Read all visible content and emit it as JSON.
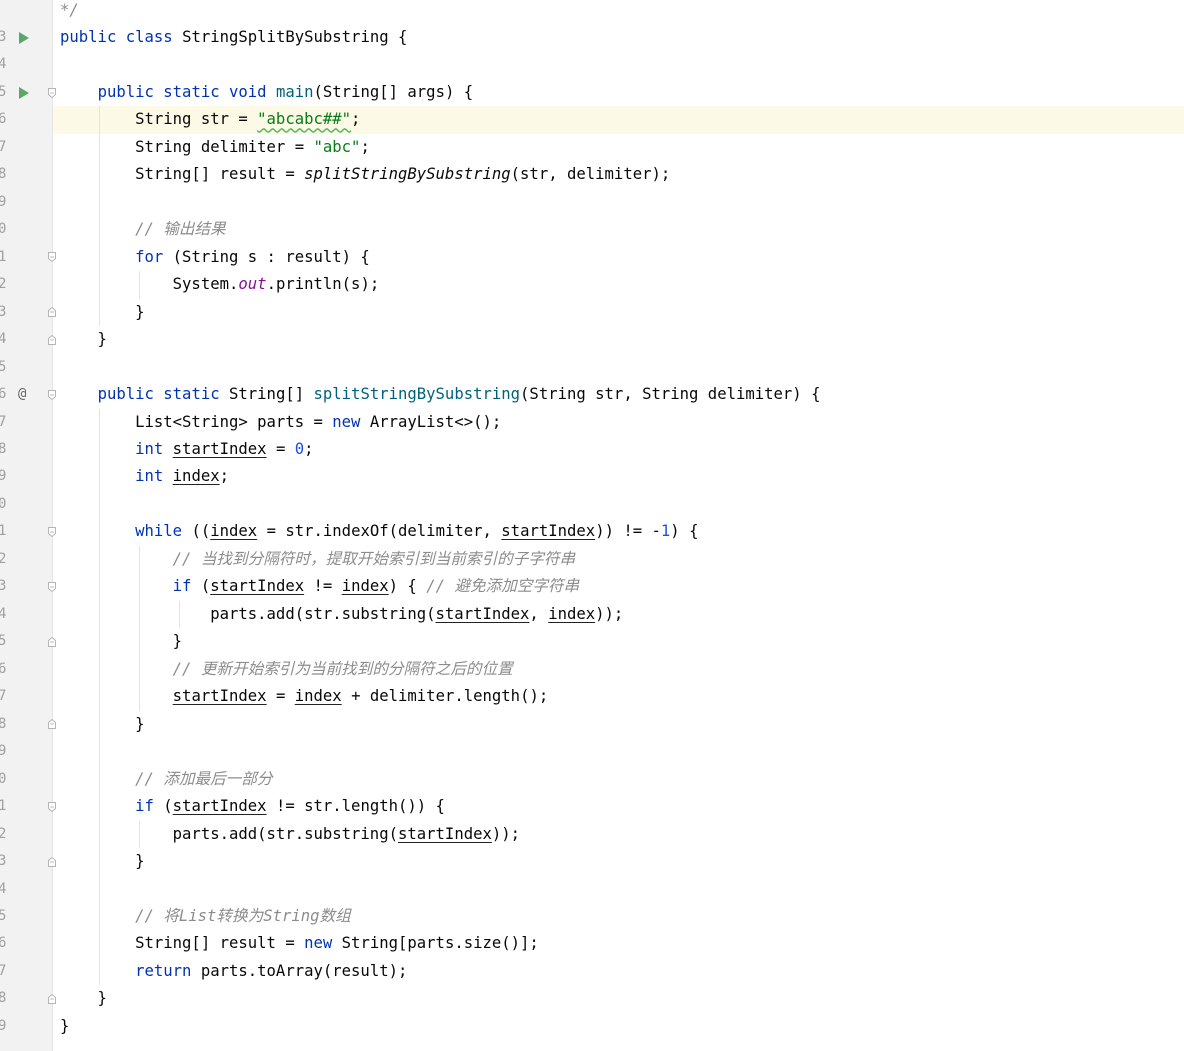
{
  "editor": {
    "line_numbers": [
      "",
      "3",
      "4",
      "5",
      "6",
      "7",
      "8",
      "9",
      "0",
      "1",
      "2",
      "3",
      "4",
      "5",
      "6",
      "7",
      "8",
      "9",
      "0",
      "1",
      "2",
      "3",
      "4",
      "5",
      "6",
      "7",
      "8",
      "9",
      "0",
      "1",
      "2",
      "3",
      "4",
      "5",
      "6",
      "7",
      "8",
      "9"
    ],
    "lines": [
      [
        {
          "t": "*/",
          "c": "cmt"
        }
      ],
      [
        {
          "t": "public class ",
          "c": "kw"
        },
        {
          "t": "StringSplitBySubstring {"
        }
      ],
      [],
      [
        {
          "t": "    "
        },
        {
          "t": "public static void ",
          "c": "kw"
        },
        {
          "t": "main",
          "c": "fn"
        },
        {
          "t": "(String[] args) {"
        }
      ],
      [
        {
          "t": "        String str = "
        },
        {
          "t": "\"abcabc##\"",
          "c": "str"
        },
        {
          "t": ";"
        }
      ],
      [
        {
          "t": "        String delimiter = "
        },
        {
          "t": "\"abc\"",
          "c": "str"
        },
        {
          "t": ";"
        }
      ],
      [
        {
          "t": "        String[] result = "
        },
        {
          "t": "splitStringBySubstring",
          "c": "static"
        },
        {
          "t": "(str, delimiter);"
        }
      ],
      [],
      [
        {
          "t": "        "
        },
        {
          "t": "// 输出结果",
          "c": "cmt"
        }
      ],
      [
        {
          "t": "        "
        },
        {
          "t": "for ",
          "c": "kw"
        },
        {
          "t": "(String s : result) {"
        }
      ],
      [
        {
          "t": "            System."
        },
        {
          "t": "out",
          "c": "field"
        },
        {
          "t": ".println(s);"
        }
      ],
      [
        {
          "t": "        }"
        }
      ],
      [
        {
          "t": "    }"
        }
      ],
      [],
      [
        {
          "t": "    "
        },
        {
          "t": "public static ",
          "c": "kw"
        },
        {
          "t": "String[] "
        },
        {
          "t": "splitStringBySubstring",
          "c": "fn"
        },
        {
          "t": "(String str, String delimiter) {"
        }
      ],
      [
        {
          "t": "        List<String> parts = "
        },
        {
          "t": "new ",
          "c": "kw"
        },
        {
          "t": "ArrayList<>();"
        }
      ],
      [
        {
          "t": "        "
        },
        {
          "t": "int ",
          "c": "kw"
        },
        {
          "t": "startIndex",
          "c": "ul"
        },
        {
          "t": " = "
        },
        {
          "t": "0",
          "c": "num"
        },
        {
          "t": ";"
        }
      ],
      [
        {
          "t": "        "
        },
        {
          "t": "int ",
          "c": "kw"
        },
        {
          "t": "index",
          "c": "ul"
        },
        {
          "t": ";"
        }
      ],
      [],
      [
        {
          "t": "        "
        },
        {
          "t": "while ",
          "c": "kw"
        },
        {
          "t": "(("
        },
        {
          "t": "index",
          "c": "ul"
        },
        {
          "t": " = str.indexOf(delimiter, "
        },
        {
          "t": "startIndex",
          "c": "ul"
        },
        {
          "t": ")) != -"
        },
        {
          "t": "1",
          "c": "num"
        },
        {
          "t": ") {"
        }
      ],
      [
        {
          "t": "            "
        },
        {
          "t": "// 当找到分隔符时，提取开始索引到当前索引的子字符串",
          "c": "cmt"
        }
      ],
      [
        {
          "t": "            "
        },
        {
          "t": "if ",
          "c": "kw"
        },
        {
          "t": "("
        },
        {
          "t": "startIndex",
          "c": "ul"
        },
        {
          "t": " != "
        },
        {
          "t": "index",
          "c": "ul"
        },
        {
          "t": ") { "
        },
        {
          "t": "// 避免添加空字符串",
          "c": "cmt"
        }
      ],
      [
        {
          "t": "                parts.add(str.substring("
        },
        {
          "t": "startIndex",
          "c": "ul"
        },
        {
          "t": ", "
        },
        {
          "t": "index",
          "c": "ul"
        },
        {
          "t": "));"
        }
      ],
      [
        {
          "t": "            }"
        }
      ],
      [
        {
          "t": "            "
        },
        {
          "t": "// 更新开始索引为当前找到的分隔符之后的位置",
          "c": "cmt"
        }
      ],
      [
        {
          "t": "            "
        },
        {
          "t": "startIndex",
          "c": "ul"
        },
        {
          "t": " = "
        },
        {
          "t": "index",
          "c": "ul"
        },
        {
          "t": " + delimiter.length();"
        }
      ],
      [
        {
          "t": "        }"
        }
      ],
      [],
      [
        {
          "t": "        "
        },
        {
          "t": "// 添加最后一部分",
          "c": "cmt"
        }
      ],
      [
        {
          "t": "        "
        },
        {
          "t": "if ",
          "c": "kw"
        },
        {
          "t": "("
        },
        {
          "t": "startIndex",
          "c": "ul"
        },
        {
          "t": " != str.length()) {"
        }
      ],
      [
        {
          "t": "            parts.add(str.substring("
        },
        {
          "t": "startIndex",
          "c": "ul"
        },
        {
          "t": "));"
        }
      ],
      [
        {
          "t": "        }"
        }
      ],
      [],
      [
        {
          "t": "        "
        },
        {
          "t": "// 将List转换为String数组",
          "c": "cmt"
        }
      ],
      [
        {
          "t": "        String[] result = "
        },
        {
          "t": "new ",
          "c": "kw"
        },
        {
          "t": "String[parts.size()];"
        }
      ],
      [
        {
          "t": "        "
        },
        {
          "t": "return ",
          "c": "kw"
        },
        {
          "t": "parts.toArray(result);"
        }
      ],
      [
        {
          "t": "    }"
        }
      ],
      [
        {
          "t": "}"
        }
      ]
    ],
    "highlighted_line": 4,
    "gutter_icons": [
      {
        "line": 1,
        "icon": "run-icon"
      },
      {
        "line": 3,
        "icon": "run-icon"
      },
      {
        "line": 14,
        "icon": "at-icon",
        "text": "@"
      }
    ],
    "fold_markers": [
      {
        "line": 3,
        "icon": "fold-open-icon"
      },
      {
        "line": 9,
        "icon": "fold-open-icon"
      },
      {
        "line": 11,
        "icon": "fold-close-icon"
      },
      {
        "line": 12,
        "icon": "fold-close-icon"
      },
      {
        "line": 14,
        "icon": "fold-open-icon"
      },
      {
        "line": 19,
        "icon": "fold-open-icon"
      },
      {
        "line": 21,
        "icon": "fold-open-icon"
      },
      {
        "line": 23,
        "icon": "fold-close-icon"
      },
      {
        "line": 26,
        "icon": "fold-close-icon"
      },
      {
        "line": 29,
        "icon": "fold-open-icon"
      },
      {
        "line": 31,
        "icon": "fold-close-icon"
      },
      {
        "line": 36,
        "icon": "fold-close-icon"
      }
    ],
    "indent_guides": [
      {
        "col": 4,
        "from": 4,
        "to": 11
      },
      {
        "col": 8,
        "from": 10,
        "to": 10
      },
      {
        "col": 4,
        "from": 15,
        "to": 35
      },
      {
        "col": 8,
        "from": 20,
        "to": 25
      },
      {
        "col": 12,
        "from": 22,
        "to": 22
      },
      {
        "col": 8,
        "from": 30,
        "to": 30
      }
    ],
    "colors": {
      "keyword": "#0033b3",
      "string": "#067d17",
      "number": "#1750eb",
      "method": "#00627a",
      "field": "#871094",
      "comment": "#8c8c8c",
      "text": "#080808",
      "gutter": "#f2f2f2",
      "current_line": "#fcfae6",
      "run_icon": "#59a869"
    }
  }
}
